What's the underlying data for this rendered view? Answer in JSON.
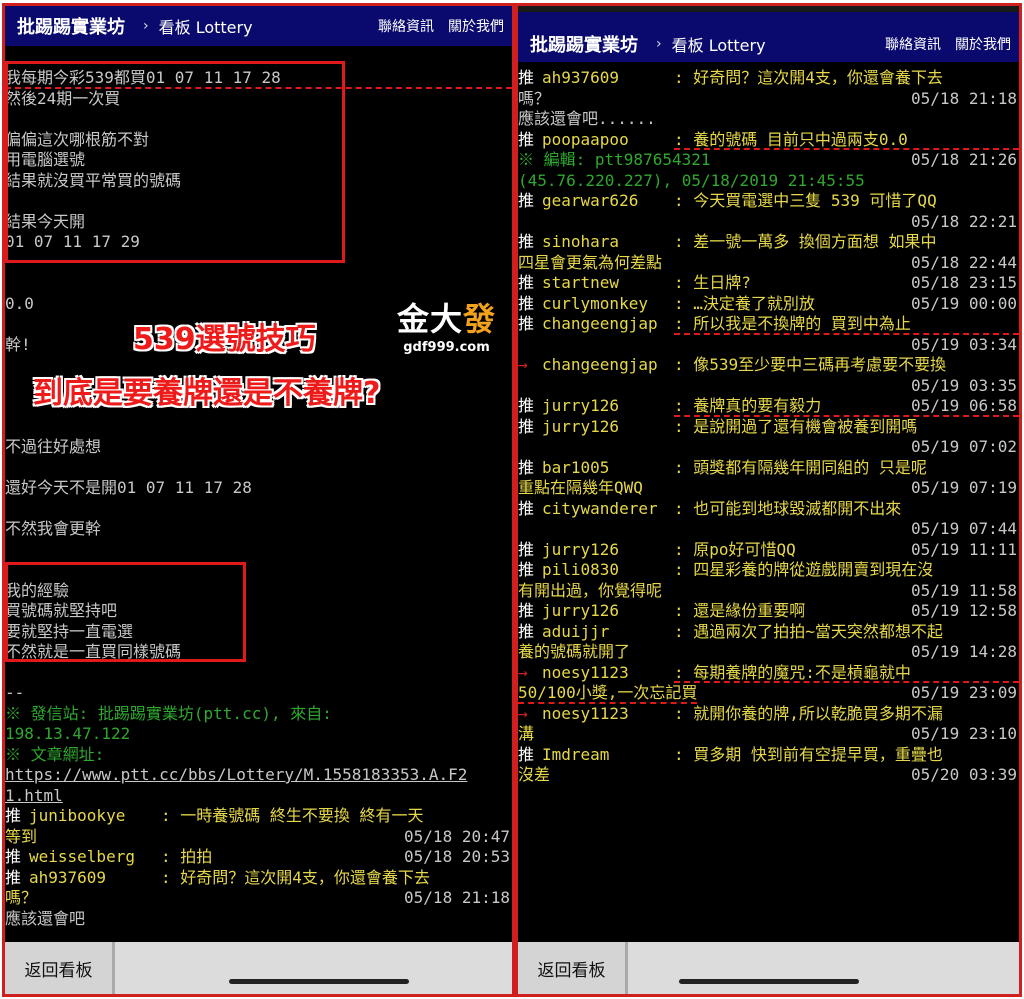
{
  "header": {
    "brand": "批踢踢實業坊",
    "sep": "›",
    "board": "看板 Lottery",
    "link_contact": "聯絡資訊",
    "link_about": "關於我們"
  },
  "left": {
    "article": [
      "我每期今彩539都買01 07 11 17 28",
      "然後24期一次買",
      "",
      "偏偏這次哪根筋不對",
      "用電腦選號",
      "結果就沒買平常買的號碼",
      "",
      "結果今天開",
      "01 07 11 17 29",
      "",
      "",
      "0.0",
      "",
      "幹!",
      "",
      "",
      "",
      "",
      "不過往好處想",
      "",
      "還好今天不是開01 07 11 17 28",
      "",
      "不然我會更幹",
      "",
      "",
      "我的經驗",
      "買號碼就堅持吧",
      "要就堅持一直電選",
      "不然就是一直買同樣號碼",
      "",
      "--"
    ],
    "sig1": "※ 發信站: 批踢踢實業坊(ptt.cc), 來自:",
    "sig2": "198.13.47.122",
    "sig3": "※ 文章網址:",
    "url1": "https://www.ptt.cc/bbs/Lottery/M.1558183353.A.F2",
    "url2": "1.html",
    "pushes": [
      {
        "tag": "推",
        "uid": "junibookye",
        "msg": ": 一時養號碼 終生不要換 終有一天",
        "wrap": "等到",
        "time": "05/18 20:47"
      },
      {
        "tag": "推",
        "uid": "weisselberg",
        "msg": ": 拍拍",
        "time": "05/18 20:53"
      },
      {
        "tag": "推",
        "uid": "ah937609",
        "msg": ": 好奇問？這次開4支，你還會養下去",
        "wrap": "嗎？",
        "time": "05/18 21:18"
      }
    ],
    "tail": "應該還會吧"
  },
  "overlay": {
    "line1": "539選號技巧",
    "line2": "到底是要養牌還是不養牌?",
    "logo_big_1": "金大",
    "logo_big_2": "發",
    "logo_small": "gdf999.com"
  },
  "right": {
    "items": [
      {
        "tag": "推",
        "uid": "ah937609",
        "msg": ": 好奇問？這次開4支，你還會養下去"
      },
      {
        "text": "嗎？",
        "time": "05/18 21:18"
      },
      {
        "text": "應該還會吧......"
      },
      {
        "tag": "推",
        "uid": "poopaapoo",
        "msg": ": 養的號碼 目前只中過兩支0.0"
      },
      {
        "green": "※ 編輯: ptt987654321",
        "time": "05/18 21:26"
      },
      {
        "green": "(45.76.220.227), 05/18/2019 21:45:55"
      },
      {
        "tag": "推",
        "uid": "gearwar626",
        "msg": ": 今天買電選中三隻 539 可惜了QQ"
      },
      {
        "timeonly": "05/18 22:21"
      },
      {
        "tag": "推",
        "uid": "sinohara",
        "msg": ": 差一號一萬多 換個方面想 如果中"
      },
      {
        "wraptext": "四星會更氣為何差點",
        "time": "05/18 22:44"
      },
      {
        "tag": "推",
        "uid": "startnew",
        "msg": ": 生日牌?",
        "time": "05/18 23:15"
      },
      {
        "tag": "推",
        "uid": "curlymonkey",
        "msg": ": …決定養了就別放",
        "time": "05/19 00:00"
      },
      {
        "tag": "推",
        "uid": "changeengjap",
        "msg": ": 所以我是不換牌的 買到中為止"
      },
      {
        "timeonly": "05/19 03:34"
      },
      {
        "tag": "→",
        "uid": "changeengjap",
        "msg": ": 像539至少要中三碼再考慮要不要換"
      },
      {
        "timeonly": "05/19 03:35"
      },
      {
        "tag": "推",
        "uid": "jurry126",
        "msg": ": 養牌真的要有毅力",
        "time": "05/19 06:58"
      },
      {
        "tag": "推",
        "uid": "jurry126",
        "msg": ": 是說開過了還有機會被養到開嗎"
      },
      {
        "timeonly": "05/19 07:02"
      },
      {
        "tag": "推",
        "uid": "bar1005",
        "msg": ": 頭獎都有隔幾年開同組的 只是呢"
      },
      {
        "wraptext": "重點在隔幾年QWQ",
        "time": "05/19 07:19"
      },
      {
        "tag": "推",
        "uid": "citywanderer",
        "msg": ": 也可能到地球毀滅都開不出來"
      },
      {
        "timeonly": "05/19 07:44"
      },
      {
        "tag": "推",
        "uid": "jurry126",
        "msg": ": 原po好可惜QQ",
        "time": "05/19 11:11"
      },
      {
        "tag": "推",
        "uid": "pili0830",
        "msg": ": 四星彩養的牌從遊戲開賣到現在沒"
      },
      {
        "wraptext": "有開出過，你覺得呢",
        "time": "05/19 11:58"
      },
      {
        "tag": "推",
        "uid": "jurry126",
        "msg": ": 還是緣份重要啊",
        "time": "05/19 12:58"
      },
      {
        "tag": "推",
        "uid": "aduijjr",
        "msg": ": 遇過兩次了拍拍~當天突然都想不起"
      },
      {
        "wraptext": "養的號碼就開了",
        "time": "05/19 14:28"
      },
      {
        "tag": "→",
        "uid": "noesy1123",
        "msg": ": 每期養牌的魔咒:不是槓龜就中"
      },
      {
        "wraptext": "50/100小獎,一次忘記買",
        "time": "05/19 23:09"
      },
      {
        "tag": "→",
        "uid": "noesy1123",
        "msg": ": 就開你養的牌,所以乾脆買多期不漏"
      },
      {
        "wraptext": "溝",
        "time": "05/19 23:10"
      },
      {
        "tag": "推",
        "uid": "Imdream",
        "msg": ": 買多期 快到前有空提早買，重疊也"
      },
      {
        "wraptext": "沒差",
        "time": "05/20 03:39"
      }
    ]
  },
  "footer": {
    "back": "返回看板"
  }
}
